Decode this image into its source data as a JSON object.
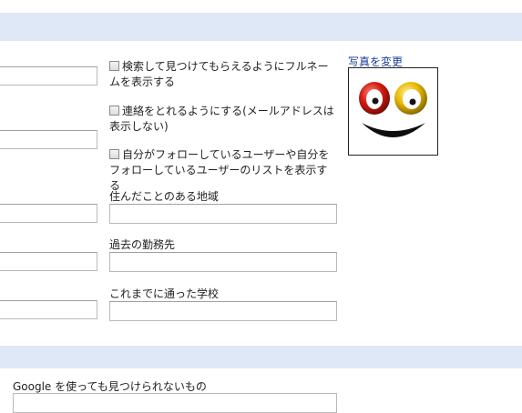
{
  "options": [
    {
      "label": "検索して見つけてもらえるようにフルネームを表示する",
      "checked": false
    },
    {
      "label": "連絡をとれるようにする(メールアドレスは表示しない)",
      "checked": false
    },
    {
      "label": "自分がフォローしているユーザーや自分をフォローしているユーザーのリストを表示する",
      "checked": false
    }
  ],
  "fields": {
    "places_lived_label": "住んだことのある地域",
    "past_employers_label": "過去の勤務先",
    "schools_label": "これまでに通った学校"
  },
  "photo": {
    "change_link": "写真を変更",
    "icon": "smiley-face-avatar"
  },
  "privacy": {
    "unsearchable_label": "Google を使っても見つけられないもの"
  },
  "colors": {
    "band": "#dfe8f7",
    "link": "#1a3c99"
  }
}
